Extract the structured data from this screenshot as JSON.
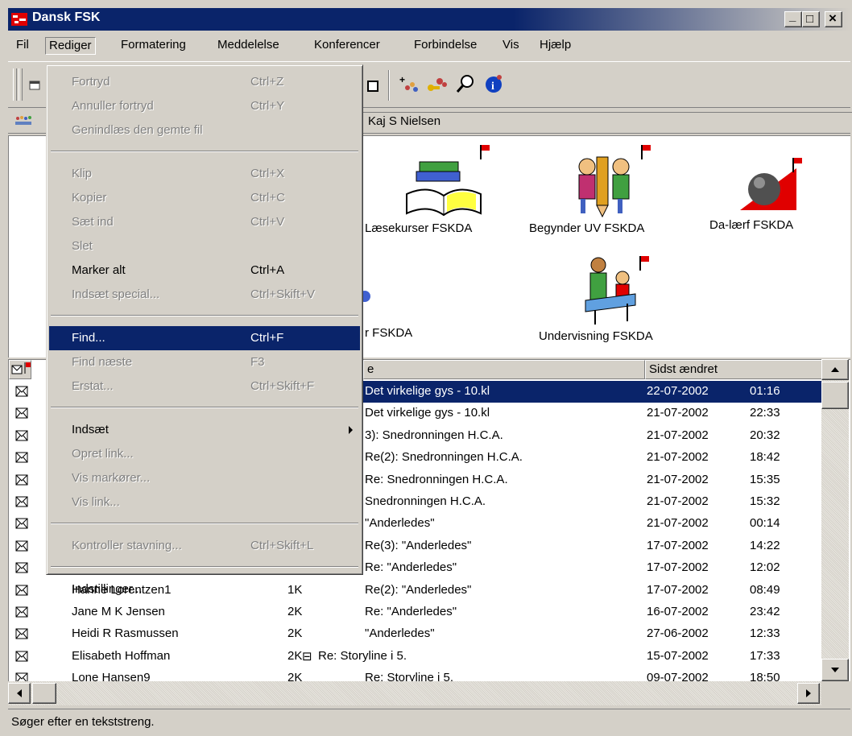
{
  "window": {
    "title": "Dansk  FSK",
    "minimize_glyph": "_",
    "maximize_glyph": "□",
    "close_glyph": "×"
  },
  "menubar": [
    {
      "label": "Fil"
    },
    {
      "label": "Rediger"
    },
    {
      "label": "Formatering"
    },
    {
      "label": "Meddelelse"
    },
    {
      "label": "Konferencer"
    },
    {
      "label": "Forbindelse"
    },
    {
      "label": "Vis"
    },
    {
      "label": "Hjælp"
    }
  ],
  "address": {
    "text": "Kaj S Nielsen"
  },
  "conferences": [
    {
      "label": "Læsekurser FSKDA"
    },
    {
      "label": "Begynder UV FSKDA"
    },
    {
      "label": "Da-lærf FSKDA"
    },
    {
      "label": "r FSKDA"
    },
    {
      "label": "Undervisning FSKDA"
    }
  ],
  "list": {
    "headers": {
      "subject": "e",
      "modified": "Sidst ændret"
    },
    "rows": [
      {
        "sender": "",
        "size": "",
        "subject": "Det virkelige gys - 10.kl",
        "date": "22-07-2002",
        "time": "01:16",
        "selected": true
      },
      {
        "sender": "",
        "size": "",
        "subject": "Det virkelige gys - 10.kl",
        "date": "21-07-2002",
        "time": "22:33"
      },
      {
        "sender": "",
        "size": "",
        "subject": "3): Snedronningen H.C.A.",
        "date": "21-07-2002",
        "time": "20:32"
      },
      {
        "sender": "",
        "size": "",
        "subject": "Re(2): Snedronningen H.C.A.",
        "date": "21-07-2002",
        "time": "18:42"
      },
      {
        "sender": "",
        "size": "",
        "subject": "Re: Snedronningen H.C.A.",
        "date": "21-07-2002",
        "time": "15:35"
      },
      {
        "sender": "",
        "size": "",
        "subject": "Snedronningen H.C.A.",
        "date": "21-07-2002",
        "time": "15:32"
      },
      {
        "sender": "",
        "size": "",
        "subject": "\"Anderledes\"",
        "date": "21-07-2002",
        "time": "00:14"
      },
      {
        "sender": "",
        "size": "",
        "subject": "Re(3): \"Anderledes\"",
        "date": "17-07-2002",
        "time": "14:22"
      },
      {
        "sender": "",
        "size": "",
        "subject": "Re: \"Anderledes\"",
        "date": "17-07-2002",
        "time": "12:02"
      },
      {
        "sender": "Hanne Lorentzen1",
        "size": "1K",
        "subject": "Re(2): \"Anderledes\"",
        "date": "17-07-2002",
        "time": "08:49"
      },
      {
        "sender": "Jane M K Jensen",
        "size": "2K",
        "subject": "Re: \"Anderledes\"",
        "date": "16-07-2002",
        "time": "23:42"
      },
      {
        "sender": "Heidi R Rasmussen",
        "size": "2K",
        "subject": "\"Anderledes\"",
        "date": "27-06-2002",
        "time": "12:33"
      },
      {
        "sender": "Elisabeth Hoffman",
        "size": "2K",
        "subject": "Re: Storyline i 5.",
        "date": "15-07-2002",
        "time": "17:33",
        "tree": "⊟"
      },
      {
        "sender": "Lone Hansen9",
        "size": "2K",
        "subject": "Re: Storyline i 5.",
        "date": "09-07-2002",
        "time": "18:50"
      }
    ]
  },
  "status": {
    "text": "Søger efter en tekststreng."
  },
  "edit_menu": {
    "items": [
      {
        "label": "Fortryd",
        "accel": "Ctrl+Z",
        "disabled": true
      },
      {
        "label": "Annuller fortryd",
        "accel": "Ctrl+Y",
        "disabled": true
      },
      {
        "label": "Genindlæs den gemte fil",
        "accel": "",
        "disabled": true
      },
      {
        "sep": true
      },
      {
        "label": "Klip",
        "accel": "Ctrl+X",
        "disabled": true
      },
      {
        "label": "Kopier",
        "accel": "Ctrl+C",
        "disabled": true
      },
      {
        "label": "Sæt ind",
        "accel": "Ctrl+V",
        "disabled": true
      },
      {
        "label": "Slet",
        "accel": "",
        "disabled": true
      },
      {
        "label": "Marker alt",
        "accel": "Ctrl+A",
        "disabled": false
      },
      {
        "label": "Indsæt special...",
        "accel": "Ctrl+Skift+V",
        "disabled": true
      },
      {
        "sep": true
      },
      {
        "label": "Find...",
        "accel": "Ctrl+F",
        "disabled": false,
        "highlighted": true
      },
      {
        "label": "Find næste",
        "accel": "F3",
        "disabled": true
      },
      {
        "label": "Erstat...",
        "accel": "Ctrl+Skift+F",
        "disabled": true
      },
      {
        "sep": true
      },
      {
        "label": "Indsæt",
        "accel": "",
        "disabled": false,
        "submenu": true
      },
      {
        "label": "Opret link...",
        "accel": "",
        "disabled": true
      },
      {
        "label": "Vis markører...",
        "accel": "",
        "disabled": true
      },
      {
        "label": "Vis link...",
        "accel": "",
        "disabled": true
      },
      {
        "sep": true
      },
      {
        "label": "Kontroller stavning...",
        "accel": "Ctrl+Skift+L",
        "disabled": true
      },
      {
        "sep": true
      },
      {
        "label": "Indstillinger...",
        "accel": "",
        "disabled": false
      }
    ]
  },
  "icons": {
    "app": "fsk-app-icon",
    "conference_flag": "red-flag-icon",
    "message": "envelope-icon"
  },
  "colors": {
    "titlebar": "#0a246a",
    "selection": "#0a246a",
    "flag": "#e00000",
    "face": "#d4d0c8"
  }
}
